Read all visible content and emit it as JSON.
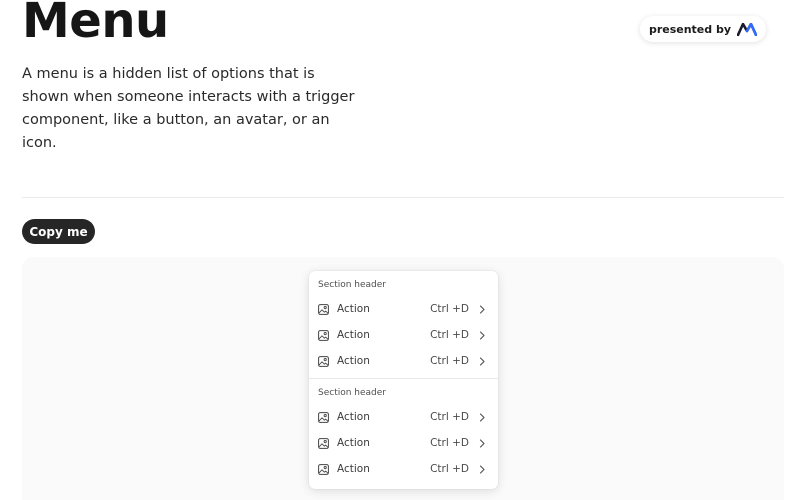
{
  "header": {
    "title": "Menu",
    "description": "A menu is a hidden list of options that is shown when someone interacts with a trigger component, like a button, an avatar, or an icon.",
    "presented_by": "presented by",
    "logo_icon": "brand-logo-icon"
  },
  "actions": {
    "copy_label": "Copy me"
  },
  "menu": {
    "sections": [
      {
        "header": "Section header",
        "items": [
          {
            "icon": "image-icon",
            "label": "Action",
            "shortcut": "Ctrl +D",
            "chevron": "chevron-right-icon"
          },
          {
            "icon": "image-icon",
            "label": "Action",
            "shortcut": "Ctrl +D",
            "chevron": "chevron-right-icon"
          },
          {
            "icon": "image-icon",
            "label": "Action",
            "shortcut": "Ctrl +D",
            "chevron": "chevron-right-icon"
          }
        ]
      },
      {
        "header": "Section header",
        "items": [
          {
            "icon": "image-icon",
            "label": "Action",
            "shortcut": "Ctrl +D",
            "chevron": "chevron-right-icon"
          },
          {
            "icon": "image-icon",
            "label": "Action",
            "shortcut": "Ctrl +D",
            "chevron": "chevron-right-icon"
          },
          {
            "icon": "image-icon",
            "label": "Action",
            "shortcut": "Ctrl +D",
            "chevron": "chevron-right-icon"
          }
        ]
      }
    ]
  },
  "colors": {
    "button_bg": "#262626",
    "canvas_bg": "#fafafa",
    "logo_dark": "#1a1a2e",
    "logo_accent": "#2f6bff"
  }
}
